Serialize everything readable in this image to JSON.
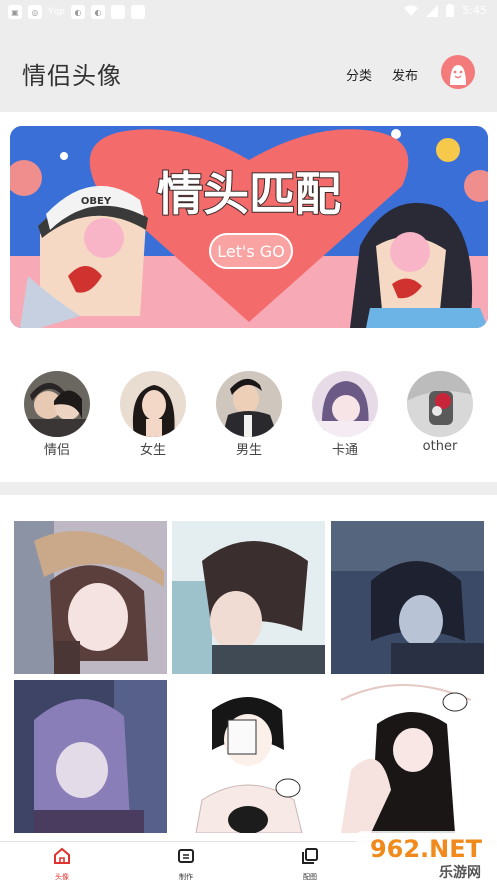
{
  "status_bar": {
    "carrier_text": "Yqp",
    "time": "5:45"
  },
  "header": {
    "title": "情侣头像",
    "category_link": "分类",
    "publish_link": "发布"
  },
  "banner": {
    "headline": "情头匹配",
    "button_text": "Let's GO",
    "cap_text": "OBEY"
  },
  "categories": [
    {
      "label": "情侣"
    },
    {
      "label": "女生"
    },
    {
      "label": "男生"
    },
    {
      "label": "卡通"
    },
    {
      "label": "other"
    }
  ],
  "bottom_nav": {
    "items": [
      {
        "label": "头像",
        "active": true
      },
      {
        "label": "制作",
        "active": false
      },
      {
        "label": "配图",
        "active": false
      }
    ]
  },
  "colors": {
    "accent": "#e0332f",
    "header_bg": "#ededed",
    "banner_blue": "#3b6fd8",
    "heart": "#f46b6b"
  },
  "watermark": {
    "text_large": "962.NET",
    "text_small": "乐游网"
  }
}
